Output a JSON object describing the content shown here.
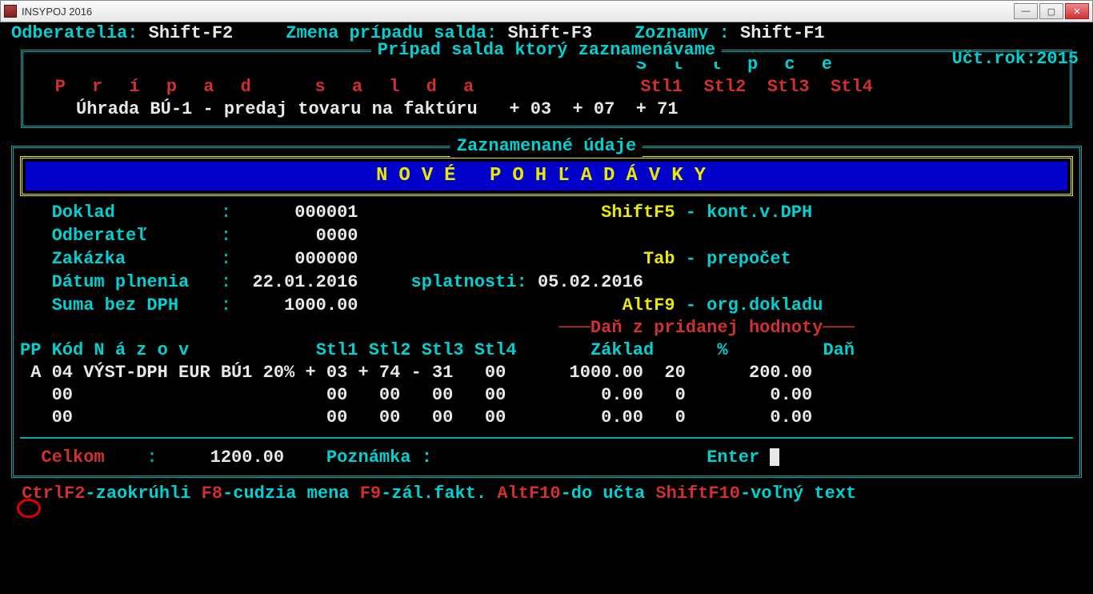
{
  "window": {
    "title": "INSYPOJ 2016"
  },
  "topbar": {
    "left_label": "Odberatelia:",
    "left_key": "Shift-F2",
    "mid_label": "Zmena prípadu salda:",
    "mid_key": "Shift-F3",
    "right_label": "Zoznamy :",
    "right_key": "Shift-F1"
  },
  "fiscal": {
    "label": "Učt.rok:",
    "year": "2015"
  },
  "box1": {
    "title": "Prípad salda ktorý zaznamenávame",
    "columns_heading": "S t l p c e",
    "case_label": "P r í p a d   s a l d a",
    "col_labels": [
      "Stl1",
      "Stl2",
      "Stl3",
      "Stl4"
    ],
    "case_desc": "Úhrada BÚ-1 - predaj tovaru na faktúru",
    "col_values": [
      "+ 03",
      "+ 07",
      "+ 71",
      ""
    ]
  },
  "box2": {
    "title": "Zaznamenané údaje",
    "banner": "NOVÉ   POHĽADÁVKY",
    "fields": {
      "doklad_label": "Doklad",
      "doklad_value": "000001",
      "shiftf5_key": "ShiftF5",
      "shiftf5_text": " - kont.v.DPH",
      "odberatel_label": "Odberateľ",
      "odberatel_value": "0000",
      "zakazka_label": "Zakázka",
      "zakazka_value": "000000",
      "tab_key": "Tab",
      "tab_text": " - prepočet",
      "datum_label": "Dátum plnenia",
      "datum_value": "22.01.2016",
      "splat_label": "splatnosti:",
      "splat_value": "05.02.2016",
      "suma_label": "Suma bez DPH",
      "suma_value": "1000.00",
      "altf9_key": "AltF9",
      "altf9_text": " - org.dokladu"
    },
    "vat": {
      "section_title": "Daň z pridanej hodnoty",
      "headers": {
        "pp": "PP",
        "kod": "Kód",
        "nazov": "N á z o v",
        "stl1": "Stl1",
        "stl2": "Stl2",
        "stl3": "Stl3",
        "stl4": "Stl4",
        "zaklad": "Základ",
        "pct": "%",
        "dan": "Daň"
      },
      "rows": [
        {
          "pp": "A",
          "kod": "04",
          "nazov": "VÝST-DPH EUR BÚ1 20%",
          "stl1": "+ 03",
          "stl2": "+ 74",
          "stl3": "- 31",
          "stl4": "00",
          "zaklad": "1000.00",
          "pct": "20",
          "dan": "200.00"
        },
        {
          "pp": " ",
          "kod": "00",
          "nazov": "",
          "stl1": "00",
          "stl2": "00",
          "stl3": "00",
          "stl4": "00",
          "zaklad": "0.00",
          "pct": "0",
          "dan": "0.00"
        },
        {
          "pp": " ",
          "kod": "00",
          "nazov": "",
          "stl1": "00",
          "stl2": "00",
          "stl3": "00",
          "stl4": "00",
          "zaklad": "0.00",
          "pct": "0",
          "dan": "0.00"
        }
      ]
    },
    "totals": {
      "celkom_label": "Celkom",
      "celkom_value": "1200.00",
      "poznamka_label": "Poznámka :",
      "enter_label": "Enter"
    }
  },
  "footer": {
    "k1": "CtrlF2",
    "t1": "-zaokrúhli ",
    "k2": "F8",
    "t2": "-cudzia mena ",
    "k3": "F9",
    "t3": "-zál.fakt. ",
    "k4": "AltF10",
    "t4": "-do učta ",
    "k5": "ShiftF10",
    "t5": "-voľný text"
  }
}
